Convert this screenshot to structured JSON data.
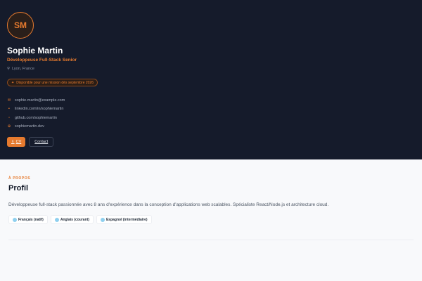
{
  "profile": {
    "initials": "SM",
    "name": "Sophie Martin",
    "role": "Développeuse Full-Stack Senior",
    "location": "Lyon, France",
    "availability": "Disponible pour une mission dès septembre 2026"
  },
  "contacts": [
    {
      "icon": "mail-icon",
      "glyph": "✉",
      "text": "sophie.martin@example.com"
    },
    {
      "icon": "linkedin-icon",
      "glyph": "▪",
      "text": "linkedin.com/in/sophiemartin"
    },
    {
      "icon": "github-icon",
      "glyph": "▫",
      "text": "github.com/sophiemartin"
    },
    {
      "icon": "globe-icon",
      "glyph": "⊕",
      "text": "sophiemartin.dev"
    }
  ],
  "actions": {
    "cv_label": "CV",
    "cv_icon": "⇩",
    "contact_label": "Contact"
  },
  "about": {
    "eyebrow": "À PROPOS",
    "title": "Profil",
    "bio": "Développeuse full-stack passionnée avec 8 ans d'expérience dans la conception d'applications web scalables. Spécialiste React/Node.js et architecture cloud.",
    "languages": [
      {
        "label": "Français (natif)"
      },
      {
        "label": "Anglais (courant)"
      },
      {
        "label": "Espagnol (intermédiaire)"
      }
    ]
  },
  "colors": {
    "accent": "#e67a2e",
    "hero_bg": "#151b2b",
    "page_bg": "#f8f9fb"
  }
}
